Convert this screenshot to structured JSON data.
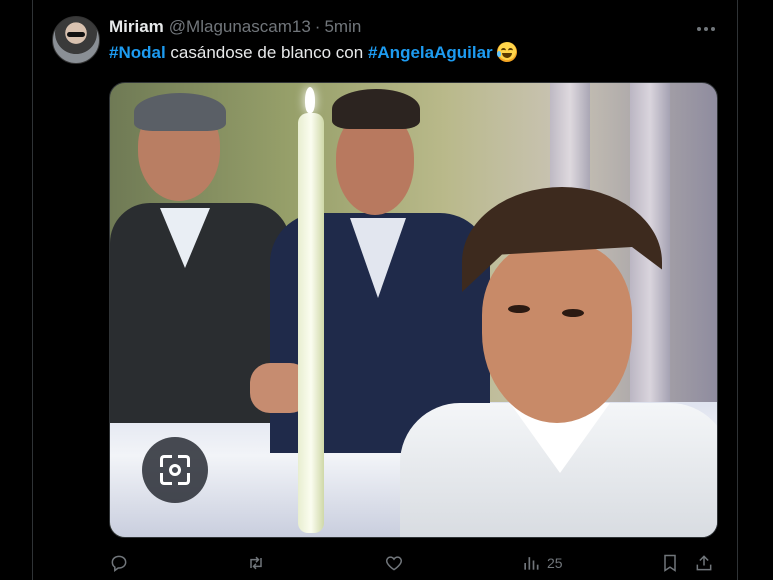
{
  "tweet": {
    "display_name": "Miriam",
    "handle": "@Mlagunascam13",
    "separator": "·",
    "time": "5min",
    "text": {
      "hashtag1": "#Nodal",
      "middle": " casándose de blanco con ",
      "hashtag2": "#AngelaAguilar",
      "emoji": "joy-emoji"
    }
  },
  "media": {
    "lens_button_icon": "google-lens-icon"
  },
  "actions": {
    "reply_icon": "reply-icon",
    "retweet_icon": "retweet-icon",
    "like_icon": "heart-icon",
    "views_icon": "views-icon",
    "views_count": "25",
    "bookmark_icon": "bookmark-icon",
    "share_icon": "share-icon"
  },
  "colors": {
    "background": "#000000",
    "text": "#e7e9ea",
    "muted": "#71767b",
    "accent": "#1d9bf0"
  }
}
